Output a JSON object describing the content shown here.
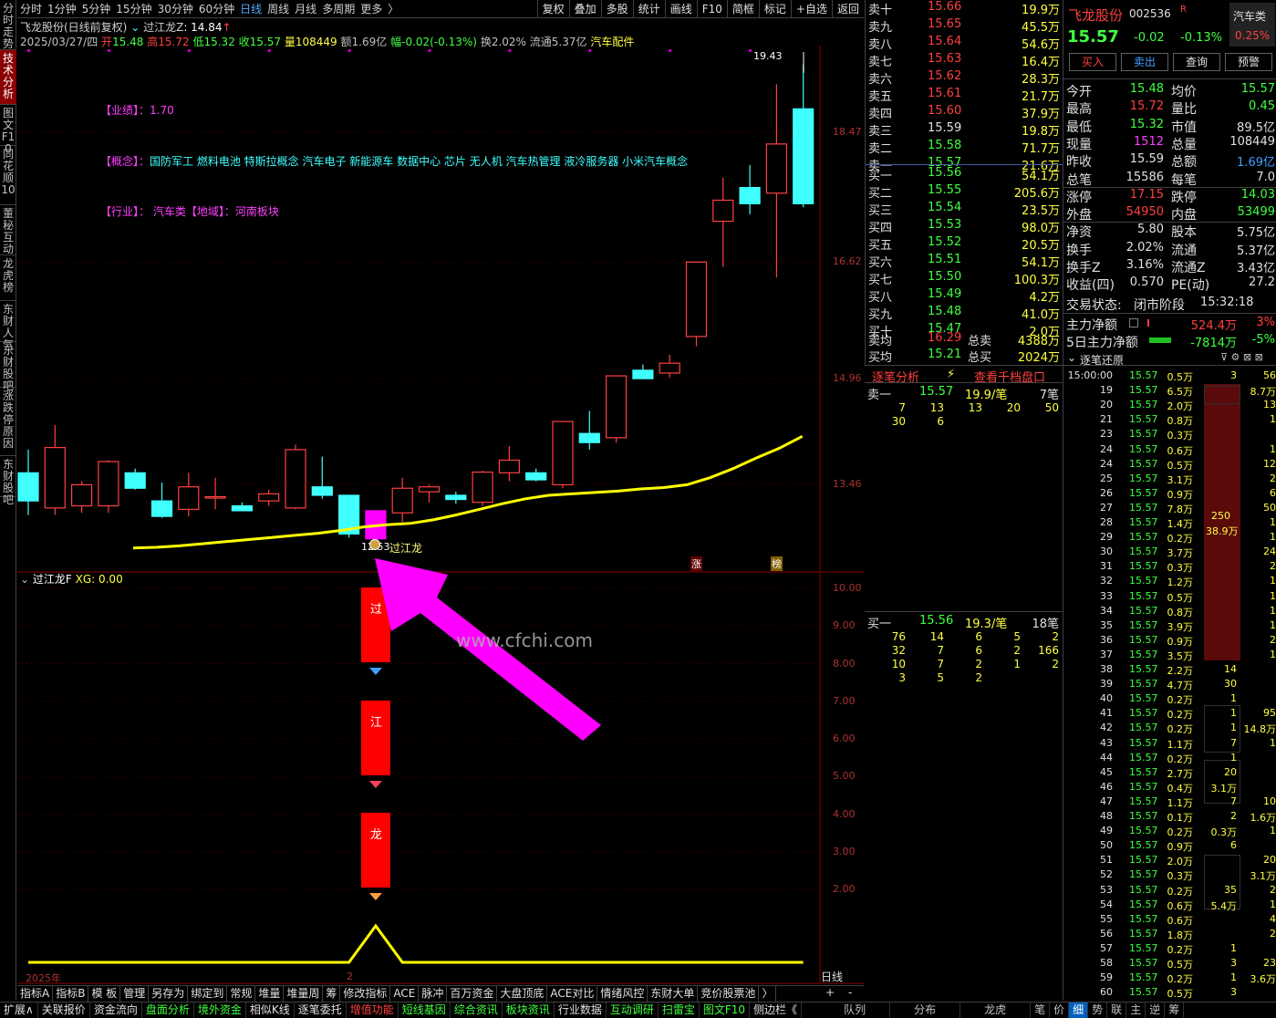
{
  "left_tabs": [
    "分时走势",
    "技术分析",
    "图文F10",
    "同花顺10",
    "董秘互动",
    "龙虎榜",
    "东财人气",
    "东财股吧",
    "涨跌停原因",
    "东财股吧"
  ],
  "periods": [
    "分时",
    "1分钟",
    "5分钟",
    "15分钟",
    "30分钟",
    "60分钟",
    "日线",
    "周线",
    "月线",
    "多周期",
    "更多"
  ],
  "period_suffix": "〉",
  "tool_buttons": [
    "复权",
    "叠加",
    "多股",
    "统计",
    "画线",
    "F10",
    "简框",
    "标记",
    "+自选",
    "返回"
  ],
  "chart_header": "飞龙股份(日线前复权)",
  "indicator_name": "过江龙Z",
  "indicator_value": ": 14.84",
  "indicator_arrow": "↑",
  "stats": {
    "date": "2025/03/27/四",
    "open_label": "开",
    "open": "15.48",
    "high_label": "高",
    "high": "15.72",
    "low_label": "低",
    "low": "15.32",
    "close_label": "收",
    "close": "15.57",
    "vol_label": "量",
    "vol": "108449",
    "amt_label": "额",
    "amt": "1.69亿",
    "chg_label": "幅",
    "chg": "-0.02(-0.13%)",
    "turn_label": "换",
    "turn": "2.02%",
    "float_label": "流通",
    "float": "5.37亿",
    "sector": "汽车配件"
  },
  "notes": {
    "perf_label": "【业绩】：",
    "perf": "1.70",
    "concept_label": "【概念】：",
    "concept": "国防军工 燃料电池 特斯拉概念 汽车电子 新能源车 数据中心 芯片 无人机 汽车热管理 液冷服务器 小米汽车概念",
    "industry_label": "【行业】：",
    "industry": "汽车类",
    "region_label": "【地域】：",
    "region": "河南板块"
  },
  "price_axis": [
    "18.47",
    "16.62",
    "14.96",
    "13.46"
  ],
  "peak_label": "19.43",
  "low_label": "12.53",
  "signal_label": "过江龙",
  "badges": [
    "涨",
    "榜"
  ],
  "osc_title": "过江龙F",
  "osc_value": "XG: 0.00",
  "osc_axis": [
    "10.00",
    "9.00",
    "8.00",
    "7.00",
    "6.00",
    "5.00",
    "4.00",
    "3.00",
    "2.00"
  ],
  "osc_bars": [
    "过",
    "江",
    "龙"
  ],
  "watermark": "www.cfchi.com",
  "year_label": "2025年",
  "month_label": "2",
  "period_box": "日线",
  "zoom": [
    "+",
    "-"
  ],
  "bottom_tabs": [
    "指标A",
    "指标B",
    "模 板",
    "管理",
    "另存为",
    "绑定到",
    "常规",
    "堆量",
    "堆量周",
    "筹",
    "修改指标",
    "ACE",
    "脉冲",
    "百万资金",
    "大盘顶底",
    "ACE对比",
    "情绪风控",
    "东财大单",
    "竞价股票池",
    "〉"
  ],
  "bottom_bar": [
    "扩展∧",
    "关联报价",
    "资金流向",
    "盘面分析",
    "境外资金",
    "相似K线",
    "逐笔委托",
    "增值功能",
    "短线基因",
    "综合资讯",
    "板块资讯",
    "行业数据",
    "互动调研",
    "扫雷宝",
    "图文F10",
    "侧边栏《",
    "队列",
    "分布",
    "龙虎",
    "笔",
    "价",
    "细",
    "势",
    "联",
    "主",
    "逆",
    "筹"
  ],
  "sells": [
    {
      "label": "卖十",
      "price": "15.66",
      "vol": "19.9万"
    },
    {
      "label": "卖九",
      "price": "15.65",
      "vol": "45.5万"
    },
    {
      "label": "卖八",
      "price": "15.64",
      "vol": "54.6万"
    },
    {
      "label": "卖七",
      "price": "15.63",
      "vol": "16.4万"
    },
    {
      "label": "卖六",
      "price": "15.62",
      "vol": "28.3万"
    },
    {
      "label": "卖五",
      "price": "15.61",
      "vol": "21.7万"
    },
    {
      "label": "卖四",
      "price": "15.60",
      "vol": "37.9万"
    },
    {
      "label": "卖三",
      "price": "15.59",
      "vol": "19.8万"
    },
    {
      "label": "卖二",
      "price": "15.58",
      "vol": "71.7万"
    },
    {
      "label": "卖一",
      "price": "15.57",
      "vol": "21.6万"
    }
  ],
  "buys": [
    {
      "label": "买一",
      "price": "15.56",
      "vol": "54.1万"
    },
    {
      "label": "买二",
      "price": "15.55",
      "vol": "205.6万"
    },
    {
      "label": "买三",
      "price": "15.54",
      "vol": "23.5万"
    },
    {
      "label": "买四",
      "price": "15.53",
      "vol": "98.0万"
    },
    {
      "label": "买五",
      "price": "15.52",
      "vol": "20.5万"
    },
    {
      "label": "买六",
      "price": "15.51",
      "vol": "54.1万"
    },
    {
      "label": "买七",
      "price": "15.50",
      "vol": "100.3万"
    },
    {
      "label": "买八",
      "price": "15.49",
      "vol": "4.2万"
    },
    {
      "label": "买九",
      "price": "15.48",
      "vol": "41.0万"
    },
    {
      "label": "买十",
      "price": "15.47",
      "vol": "2.0万"
    }
  ],
  "avg_sell": {
    "label": "卖均",
    "price": "16.29",
    "tlabel": "总卖",
    "total": "4388万"
  },
  "avg_buy": {
    "label": "买均",
    "price": "15.21",
    "tlabel": "总买",
    "total": "2024万"
  },
  "tick_analysis": "逐笔分析",
  "view_queue": "查看千档盘口",
  "sell1_queue": {
    "label": "卖一",
    "price": "15.57",
    "avg": "19.9/笔",
    "count": "7笔",
    "rows": [
      [
        "7",
        "13",
        "13",
        "20",
        "50"
      ],
      [
        "30",
        "6"
      ]
    ]
  },
  "buy1_queue": {
    "label": "买一",
    "price": "15.56",
    "avg": "19.3/笔",
    "count": "18笔",
    "rows": [
      [
        "76",
        "14",
        "6",
        "5",
        "2"
      ],
      [
        "32",
        "7",
        "6",
        "2",
        "166"
      ],
      [
        "10",
        "7",
        "2",
        "1",
        "2"
      ],
      [
        "3",
        "5",
        "2"
      ]
    ]
  },
  "stock": {
    "name": "飞龙股份",
    "code": "002536",
    "flag": "R",
    "sector": "汽车类",
    "price": "15.57",
    "chg": "-0.02",
    "pct": "-0.13%",
    "sector_pct": "0.25%"
  },
  "actions": [
    "买入",
    "卖出",
    "查询",
    "预警"
  ],
  "quote_rows": [
    [
      "今开",
      "15.48",
      "均价",
      "15.57"
    ],
    [
      "最高",
      "15.72",
      "量比",
      "0.45"
    ],
    [
      "最低",
      "15.32",
      "市值",
      "89.5亿"
    ],
    [
      "现量",
      "1512",
      "总量",
      "108449"
    ],
    [
      "昨收",
      "15.59",
      "总额",
      "1.69亿"
    ],
    [
      "总笔",
      "15586",
      "每笔",
      "7.0"
    ],
    [
      "涨停",
      "17.15",
      "跌停",
      "14.03"
    ],
    [
      "外盘",
      "54950",
      "内盘",
      "53499"
    ],
    [
      "净资",
      "5.80",
      "股本",
      "5.75亿"
    ],
    [
      "换手",
      "2.02%",
      "流通",
      "5.37亿"
    ],
    [
      "换手Z",
      "3.16%",
      "流通Z",
      "3.43亿"
    ],
    [
      "收益(四)",
      "0.570",
      "PE(动)",
      "27.2"
    ]
  ],
  "trade_status": {
    "label": "交易状态:",
    "value": "闭市阶段",
    "time": "15:32:18"
  },
  "main_net": {
    "label": "主力净额",
    "value": "524.4万",
    "pct": "3%"
  },
  "main_net5": {
    "label": "5日主力净额",
    "value": "-7814万",
    "pct": "-5%"
  },
  "tick_title": "逐笔还原",
  "ticks": [
    [
      "15:00:00",
      "15.57",
      "0.5万",
      "3",
      "56"
    ],
    [
      "19",
      "15.57",
      "6.5万",
      "",
      "8.7万"
    ],
    [
      "20",
      "15.57",
      "2.0万",
      "",
      "13"
    ],
    [
      "21",
      "15.57",
      "0.8万",
      "",
      "1"
    ],
    [
      "23",
      "15.57",
      "0.3万",
      "",
      ""
    ],
    [
      "24",
      "15.57",
      "0.6万",
      "",
      "1"
    ],
    [
      "24",
      "15.57",
      "0.5万",
      "",
      "12"
    ],
    [
      "25",
      "15.57",
      "3.1万",
      "",
      "2"
    ],
    [
      "26",
      "15.57",
      "0.9万",
      "",
      "6"
    ],
    [
      "27",
      "15.57",
      "7.8万",
      "",
      "50"
    ],
    [
      "28",
      "15.57",
      "1.4万",
      "",
      "1"
    ],
    [
      "29",
      "15.57",
      "0.2万",
      "",
      "1"
    ],
    [
      "30",
      "15.57",
      "3.7万",
      "",
      "24"
    ],
    [
      "31",
      "15.57",
      "0.3万",
      "",
      "2"
    ],
    [
      "32",
      "15.57",
      "1.2万",
      "",
      "1"
    ],
    [
      "33",
      "15.57",
      "0.5万",
      "",
      "1"
    ],
    [
      "34",
      "15.57",
      "0.8万",
      "",
      "1"
    ],
    [
      "35",
      "15.57",
      "3.9万",
      "",
      "1"
    ],
    [
      "36",
      "15.57",
      "0.9万",
      "",
      "2"
    ],
    [
      "37",
      "15.57",
      "3.5万",
      "",
      "1"
    ],
    [
      "38",
      "15.57",
      "2.2万",
      "14",
      ""
    ],
    [
      "39",
      "15.57",
      "4.7万",
      "30",
      ""
    ],
    [
      "40",
      "15.57",
      "0.2万",
      "1",
      ""
    ],
    [
      "41",
      "15.57",
      "0.2万",
      "1",
      "95"
    ],
    [
      "42",
      "15.57",
      "0.2万",
      "1",
      "14.8万"
    ],
    [
      "43",
      "15.57",
      "1.1万",
      "7",
      "1"
    ],
    [
      "44",
      "15.57",
      "0.2万",
      "1",
      ""
    ],
    [
      "45",
      "15.57",
      "2.7万",
      "20",
      ""
    ],
    [
      "46",
      "15.57",
      "0.4万",
      "3.1万",
      ""
    ],
    [
      "47",
      "15.57",
      "1.1万",
      "7",
      "10"
    ],
    [
      "48",
      "15.57",
      "0.1万",
      "2",
      "1.6万"
    ],
    [
      "49",
      "15.57",
      "0.2万",
      "0.3万",
      "1"
    ],
    [
      "50",
      "15.57",
      "0.9万",
      "6",
      ""
    ],
    [
      "51",
      "15.57",
      "2.0万",
      "",
      "20"
    ],
    [
      "52",
      "15.57",
      "0.3万",
      "",
      "3.1万"
    ],
    [
      "53",
      "15.57",
      "0.2万",
      "35",
      "2"
    ],
    [
      "54",
      "15.57",
      "0.6万",
      "5.4万",
      "1"
    ],
    [
      "55",
      "15.57",
      "0.6万",
      "",
      "4"
    ],
    [
      "56",
      "15.57",
      "1.8万",
      "",
      "2"
    ],
    [
      "57",
      "15.57",
      "0.2万",
      "1",
      ""
    ],
    [
      "58",
      "15.57",
      "0.5万",
      "3",
      "23"
    ],
    [
      "59",
      "15.57",
      "0.2万",
      "1",
      "3.6万"
    ],
    [
      "60",
      "15.57",
      "0.5万",
      "3",
      ""
    ]
  ],
  "big_order": {
    "count": "250",
    "amount": "38.9万"
  },
  "colors": {
    "up": "#ff4040",
    "down": "#40ffff",
    "ma": "#ffff00",
    "magenta": "#ff00ff",
    "grid": "#8b0000"
  },
  "chart_data": {
    "type": "candlestick",
    "title": "飞龙股份(日线前复权)",
    "candles": [
      {
        "o": 13.62,
        "h": 13.95,
        "l": 13.02,
        "c": 13.22
      },
      {
        "o": 13.12,
        "h": 14.3,
        "l": 13.02,
        "c": 13.98
      },
      {
        "o": 13.15,
        "h": 13.5,
        "l": 13.05,
        "c": 13.45
      },
      {
        "o": 13.15,
        "h": 13.8,
        "l": 13.05,
        "c": 13.78
      },
      {
        "o": 13.62,
        "h": 13.68,
        "l": 13.38,
        "c": 13.4
      },
      {
        "o": 13.22,
        "h": 13.48,
        "l": 12.98,
        "c": 13.0
      },
      {
        "o": 13.1,
        "h": 13.62,
        "l": 13.0,
        "c": 13.42
      },
      {
        "o": 13.28,
        "h": 13.55,
        "l": 13.1,
        "c": 13.28
      },
      {
        "o": 13.15,
        "h": 13.2,
        "l": 13.08,
        "c": 13.08
      },
      {
        "o": 13.22,
        "h": 13.38,
        "l": 13.15,
        "c": 13.32
      },
      {
        "o": 13.12,
        "h": 14.02,
        "l": 13.1,
        "c": 13.95
      },
      {
        "o": 13.42,
        "h": 13.85,
        "l": 13.25,
        "c": 13.3
      },
      {
        "o": 13.3,
        "h": 13.3,
        "l": 12.7,
        "c": 12.75
      },
      {
        "o": 12.68,
        "h": 13.08,
        "l": 12.58,
        "c": 13.08
      },
      {
        "o": 13.05,
        "h": 13.55,
        "l": 12.92,
        "c": 13.4
      },
      {
        "o": 13.35,
        "h": 13.45,
        "l": 13.2,
        "c": 13.42
      },
      {
        "o": 13.3,
        "h": 13.35,
        "l": 13.18,
        "c": 13.24
      },
      {
        "o": 13.2,
        "h": 13.65,
        "l": 13.15,
        "c": 13.63
      },
      {
        "o": 13.62,
        "h": 14.0,
        "l": 13.5,
        "c": 13.8
      },
      {
        "o": 13.62,
        "h": 13.68,
        "l": 13.5,
        "c": 13.52
      },
      {
        "o": 13.45,
        "h": 14.35,
        "l": 13.4,
        "c": 14.35
      },
      {
        "o": 14.18,
        "h": 14.5,
        "l": 13.95,
        "c": 14.05
      },
      {
        "o": 14.12,
        "h": 15.0,
        "l": 14.05,
        "c": 15.0
      },
      {
        "o": 15.08,
        "h": 15.16,
        "l": 14.96,
        "c": 14.96
      },
      {
        "o": 15.04,
        "h": 15.3,
        "l": 14.98,
        "c": 15.18
      },
      {
        "o": 15.56,
        "h": 16.62,
        "l": 15.42,
        "c": 16.62
      },
      {
        "o": 17.2,
        "h": 17.82,
        "l": 16.55,
        "c": 17.5
      },
      {
        "o": 17.68,
        "h": 18.0,
        "l": 17.3,
        "c": 17.45
      },
      {
        "o": 17.6,
        "h": 19.15,
        "l": 16.4,
        "c": 18.3
      },
      {
        "o": 18.8,
        "h": 19.43,
        "l": 17.4,
        "c": 17.45
      }
    ],
    "ma_line": [
      12.55,
      12.56,
      12.58,
      12.61,
      12.64,
      12.67,
      12.7,
      12.73,
      12.76,
      12.8,
      12.85,
      12.88,
      12.9,
      12.95,
      13.02,
      13.1,
      13.18,
      13.25,
      13.3,
      13.32,
      13.34,
      13.36,
      13.39,
      13.41,
      13.45,
      13.55,
      13.68,
      13.83,
      13.97,
      14.14
    ],
    "osc_line": [
      0,
      0,
      0,
      0,
      0,
      0,
      0,
      0,
      0,
      0,
      0,
      0,
      0,
      1,
      0,
      0,
      0,
      0,
      0,
      0,
      0,
      0,
      0,
      0,
      0,
      0,
      0,
      0,
      0,
      0
    ],
    "ylim": [
      12.3,
      19.7
    ]
  }
}
